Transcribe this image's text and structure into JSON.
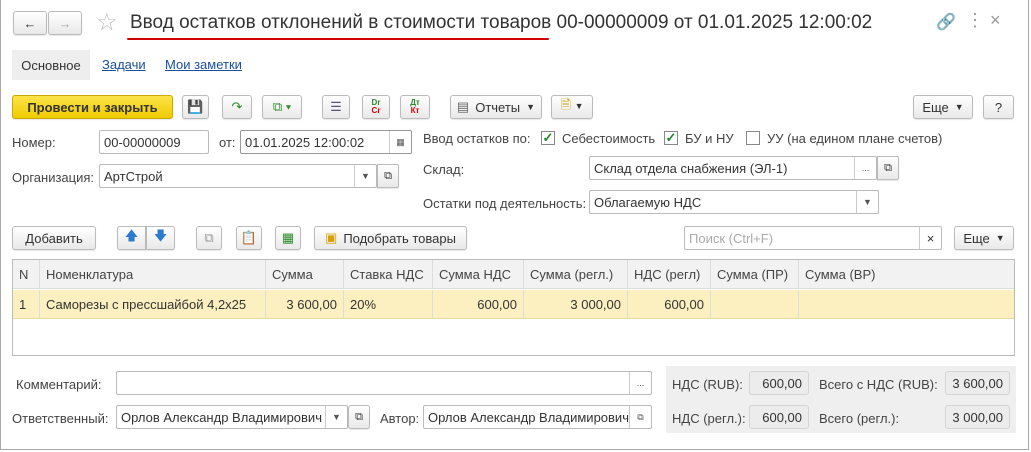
{
  "title": "Ввод остатков отклонений в стоимости товаров 00-00000009 от 01.01.2025 12:00:02",
  "tabs": [
    {
      "label": "Основное"
    },
    {
      "label": "Задачи"
    },
    {
      "label": "Мои заметки"
    }
  ],
  "toolbar": {
    "post_close": "Провести и закрыть",
    "reports": "Отчеты",
    "more": "Еще",
    "help": "?",
    "dr": "Dr",
    "cr": "Cr",
    "dt": "Дт",
    "kt": "Кт"
  },
  "form": {
    "number_label": "Номер:",
    "number": "00-00000009",
    "date_label": "от:",
    "date": "01.01.2025 12:00:02",
    "org_label": "Организация:",
    "org": "АртСтрой",
    "balances_by_label": "Ввод остатков по:",
    "cb_cost": {
      "label": "Себестоимость",
      "checked": true
    },
    "cb_bu": {
      "label": "БУ и НУ",
      "checked": true
    },
    "cb_uu": {
      "label": "УУ (на едином плане счетов)",
      "checked": false
    },
    "warehouse_label": "Склад:",
    "warehouse": "Склад отдела снабжения (ЭЛ-1)",
    "activity_label": "Остатки под деятельность:",
    "activity": "Облагаемую НДС"
  },
  "table_toolbar": {
    "add": "Добавить",
    "pick": "Подобрать товары",
    "search_placeholder": "Поиск (Ctrl+F)",
    "more": "Еще"
  },
  "table": {
    "columns": [
      "N",
      "Номенклатура",
      "Сумма",
      "Ставка НДС",
      "Сумма НДС",
      "Сумма (регл.)",
      "НДС (регл)",
      "Сумма (ПР)",
      "Сумма (ВР)"
    ],
    "rows": [
      [
        "1",
        "Саморезы с прессшайбой 4,2х25",
        "3 600,00",
        "20%",
        "600,00",
        "3 000,00",
        "600,00",
        "",
        ""
      ]
    ]
  },
  "footer": {
    "comment_label": "Комментарий:",
    "comment": "",
    "responsible_label": "Ответственный:",
    "responsible": "Орлов Александр Владимирович",
    "author_label": "Автор:",
    "author": "Орлов Александр Владимирович",
    "vat_rub_label": "НДС (RUB):",
    "vat_rub": "600,00",
    "total_rub_label": "Всего с НДС (RUB):",
    "total_rub": "3 600,00",
    "vat_reg_label": "НДС (регл.):",
    "vat_reg": "600,00",
    "total_reg_label": "Всего (регл.):",
    "total_reg": "3 000,00"
  },
  "colors": {
    "primary_button": "#f5d60c",
    "selected_row": "#fcefc0",
    "title_underline": "#d00000"
  }
}
